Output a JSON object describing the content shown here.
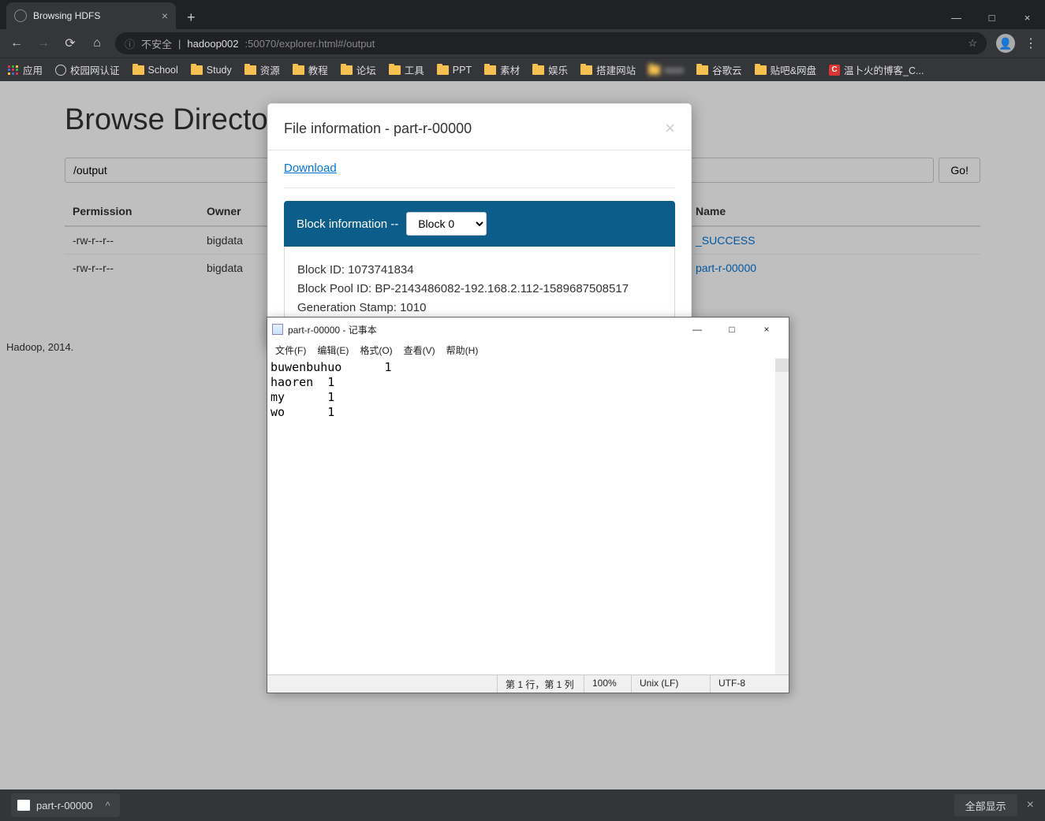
{
  "browser": {
    "tab_title": "Browsing HDFS",
    "insecure_label": "不安全",
    "url_host": "hadoop002",
    "url_port_path": ":50070/explorer.html#/output",
    "bookmarks": {
      "apps": "应用",
      "items": [
        {
          "icon": "globe",
          "label": "校园网认证"
        },
        {
          "icon": "folder",
          "label": "School"
        },
        {
          "icon": "folder",
          "label": "Study"
        },
        {
          "icon": "folder",
          "label": "资源"
        },
        {
          "icon": "folder",
          "label": "教程"
        },
        {
          "icon": "folder",
          "label": "论坛"
        },
        {
          "icon": "folder",
          "label": "工具"
        },
        {
          "icon": "folder",
          "label": "PPT"
        },
        {
          "icon": "folder",
          "label": "素材"
        },
        {
          "icon": "folder",
          "label": "娱乐"
        },
        {
          "icon": "folder",
          "label": "搭建网站"
        },
        {
          "icon": "blur",
          "label": "xxxx"
        },
        {
          "icon": "folder",
          "label": "谷歌云"
        },
        {
          "icon": "folder",
          "label": "贴吧&网盘"
        },
        {
          "icon": "red",
          "label": "温卜火的博客_C..."
        }
      ]
    }
  },
  "page": {
    "heading": "Browse Directory",
    "path_value": "/output",
    "go_label": "Go!",
    "columns": {
      "permission": "Permission",
      "owner": "Owner",
      "name": "Name"
    },
    "rows": [
      {
        "permission": "-rw-r--r--",
        "owner": "bigdata",
        "name": "_SUCCESS"
      },
      {
        "permission": "-rw-r--r--",
        "owner": "bigdata",
        "name": "part-r-00000"
      }
    ],
    "footer": "Hadoop, 2014."
  },
  "modal": {
    "title": "File information - part-r-00000",
    "download": "Download",
    "block_info_label": "Block information -- ",
    "block_selected": "Block 0",
    "block_id": "Block ID: 1073741834",
    "pool_id": "Block Pool ID: BP-2143486082-192.168.2.112-1589687508517",
    "gen_stamp": "Generation Stamp: 1010"
  },
  "notepad": {
    "title": "part-r-00000 - 记事本",
    "menu": [
      "文件(F)",
      "编辑(E)",
      "格式(O)",
      "查看(V)",
      "帮助(H)"
    ],
    "content": "buwenbuhuo\t1\nhaoren\t1\nmy\t1\nwo\t1",
    "status": {
      "pos": "第 1 行，第 1 列",
      "zoom": "100%",
      "eol": "Unix (LF)",
      "enc": "UTF-8"
    }
  },
  "download_bar": {
    "filename": "part-r-00000",
    "show_all": "全部显示"
  }
}
